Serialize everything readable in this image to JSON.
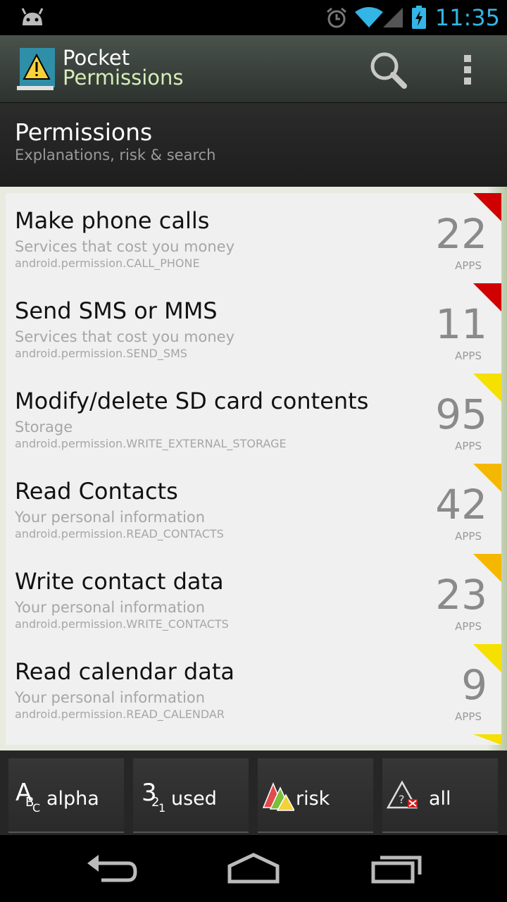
{
  "status": {
    "time": "11:35"
  },
  "app": {
    "title_line1": "Pocket",
    "title_line2": "Permissions"
  },
  "header": {
    "title": "Permissions",
    "subtitle": "Explanations, risk & search"
  },
  "permissions": [
    {
      "title": "Make phone calls",
      "category": "Services that cost you money",
      "permission": "android.permission.CALL_PHONE",
      "count": "22",
      "apps_label": "APPS",
      "risk_color": "#d10000"
    },
    {
      "title": "Send SMS or MMS",
      "category": "Services that cost you money",
      "permission": "android.permission.SEND_SMS",
      "count": "11",
      "apps_label": "APPS",
      "risk_color": "#d10000"
    },
    {
      "title": "Modify/delete SD card contents",
      "category": "Storage",
      "permission": "android.permission.WRITE_EXTERNAL_STORAGE",
      "count": "95",
      "apps_label": "APPS",
      "risk_color": "#f5e000"
    },
    {
      "title": "Read Contacts",
      "category": "Your personal information",
      "permission": "android.permission.READ_CONTACTS",
      "count": "42",
      "apps_label": "APPS",
      "risk_color": "#f5b800"
    },
    {
      "title": "Write contact data",
      "category": "Your personal information",
      "permission": "android.permission.WRITE_CONTACTS",
      "count": "23",
      "apps_label": "APPS",
      "risk_color": "#f5b800"
    },
    {
      "title": "Read calendar data",
      "category": "Your personal information",
      "permission": "android.permission.READ_CALENDAR",
      "count": "9",
      "apps_label": "APPS",
      "risk_color": "#f5e000"
    }
  ],
  "tabs": [
    {
      "label": "alpha",
      "icon": "alpha-sort-icon"
    },
    {
      "label": "used",
      "icon": "usage-sort-icon"
    },
    {
      "label": "risk",
      "icon": "risk-sort-icon"
    },
    {
      "label": "all",
      "icon": "all-filter-icon"
    }
  ],
  "colors": {
    "accent_blue": "#33b5e5",
    "title_green": "#d6edb7"
  }
}
